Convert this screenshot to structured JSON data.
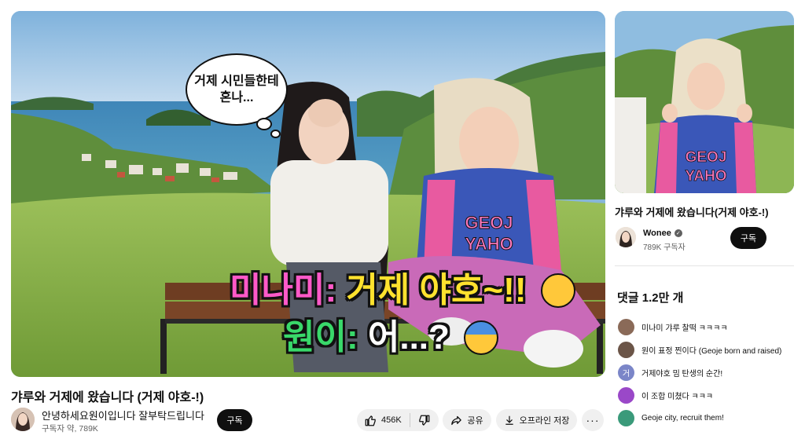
{
  "video": {
    "speech_bubble": {
      "line1": "거제 시민들한테",
      "line2": "혼나..."
    },
    "subtitle1": {
      "speaker": "미나미:",
      "text": "거제 야호~!!"
    },
    "subtitle2": {
      "speaker": "원이:",
      "text": "어...?"
    },
    "jersey_text": "GEOJE YAHO"
  },
  "title": "갸루와 거제에 왔습니다 (거제 야호-!)",
  "channel": {
    "name": "안녕하세요원이입니다 잘부탁드립니다",
    "subscribers": "구독자 약, 789K",
    "subscribe_label": "구독"
  },
  "actions": {
    "likes": "456K",
    "share_label": "공유",
    "download_label": "오프라인 저장",
    "more_label": "···"
  },
  "sidebar": {
    "jersey_text": "GEOJE YAHO",
    "title": "갸루와 거제에 왔습니다(거제 야호-!)",
    "channel_name": "Wonee",
    "verified_mark": "✓",
    "subscribers": "789K 구독자",
    "subscribe_label": "구독",
    "comments_header": "댓글 1.2만 개",
    "comments": [
      {
        "text": "미나미 갸루 찰떡 ㅋㅋㅋㅋ",
        "avatar_letter": "",
        "avatar_color": "#8a6a58"
      },
      {
        "text": "원이 표정 찐이다 (Geoje born and raised)",
        "avatar_letter": "",
        "avatar_color": "#6b5548"
      },
      {
        "text": "거제야호 밈 탄생의 순간!",
        "avatar_letter": "거",
        "avatar_color": "#7b86c8"
      },
      {
        "text": "이 조합 미쳤다 ㅋㅋㅋ",
        "avatar_letter": "",
        "avatar_color": "#9a48c8"
      },
      {
        "text": "Geoje city, recruit them!",
        "avatar_letter": "",
        "avatar_color": "#3a9a7a"
      }
    ]
  }
}
